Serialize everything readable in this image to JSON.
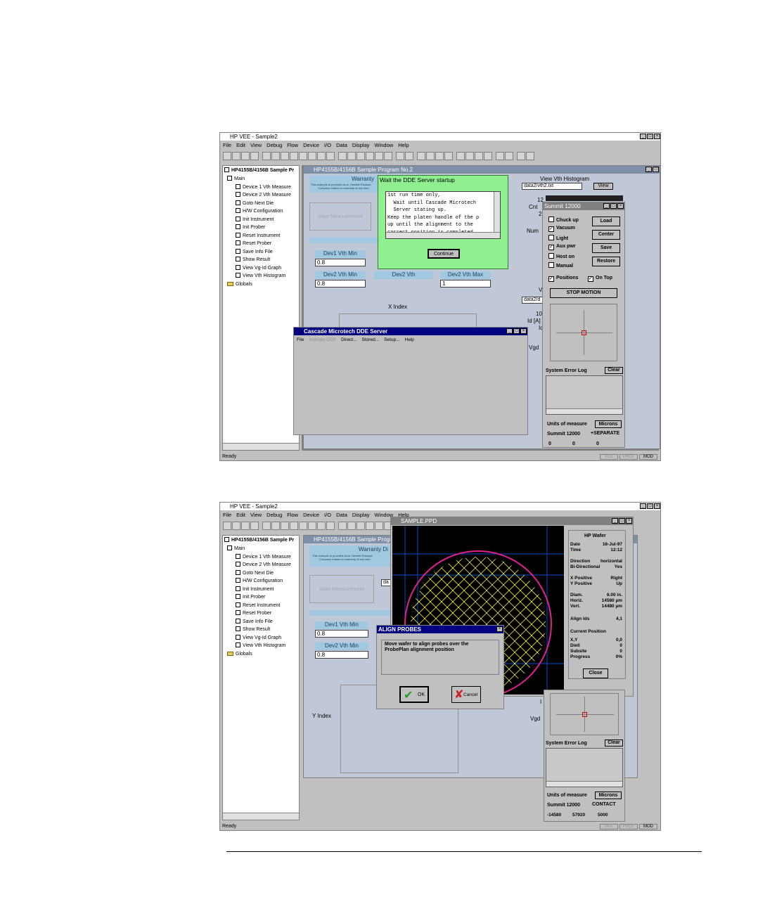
{
  "screen1": {
    "app_title": "HP VEE - Sample2",
    "menu": [
      "File",
      "Edit",
      "View",
      "Debug",
      "Flow",
      "Device",
      "I/O",
      "Data",
      "Display",
      "Window",
      "Help"
    ],
    "tree_root": "HP4155B/4156B Sample Pr",
    "tree_items": [
      "Main",
      "Device 1 Vth Measure",
      "Device 2 Vth Measure",
      "Goto Next Die",
      "H/W Configuration",
      "Init Instrument",
      "Init Prober",
      "Reset Instrument",
      "Reset Prober",
      "Save Info File",
      "Show Result",
      "View Vg-Id Graph",
      "View Vth Histogram",
      "Globals"
    ],
    "status_ready": "Ready",
    "status_indicators": [
      "VEE",
      "PROF",
      "MOD"
    ],
    "program_title": "HP4155B/4156B Sample Program No.2",
    "warranty_title": "Warranty",
    "warranty_text_1": "This example is provided as-is. Hewlett-Packard",
    "warranty_text_2": "Company makes no warranty of any kind",
    "start_button": "Start Measurement",
    "labels": {
      "dev1_vth_min": "Dev1 Vth Min",
      "dev2_vth_min": "Dev2 Vth Min",
      "dev2_vth": "Dev2 Vth",
      "dev2_vth_max": "Dev2 Vth Max"
    },
    "values": {
      "dev1_vth_min": "0.8",
      "dev2_vth_min": "0.8",
      "dev2_vth_max": "1"
    },
    "x_index": "X Index",
    "view_vth_histogram": "View Vth Histogram",
    "hist_file": "data2/vth2.txt",
    "view_button": "View",
    "side_labels": [
      "12",
      "Cnt",
      "2",
      "Num",
      "V",
      "data2/d",
      "10",
      "Id [A]",
      "Id",
      "Vgd"
    ],
    "dialog_title": "Wait the DDE Server startup",
    "dialog_lines": [
      "1st run time only,",
      "  Wait until Cascade Microtech",
      "  Server stating up.",
      "Keep the platen handle of the p",
      "up until the alignment to the",
      "correct position is completed"
    ],
    "continue_button": "Continue",
    "dde_title": "Cascade Microtech DDE Server",
    "dde_menu": [
      "File",
      "Activate DDE",
      "Direct...",
      "Stored...",
      "Setup...",
      "Help"
    ],
    "summit_title": "Summit 12000",
    "summit_checks": [
      {
        "label": "Chuck up",
        "checked": false
      },
      {
        "label": "Vacuum",
        "checked": true
      },
      {
        "label": "Light",
        "checked": false
      },
      {
        "label": "Aux pwr",
        "checked": true
      },
      {
        "label": "Host on",
        "checked": false
      },
      {
        "label": "Manual",
        "checked": false
      }
    ],
    "summit_buttons": [
      "Load",
      "Center",
      "Save",
      "Restore"
    ],
    "positions": "Positions",
    "on_top": "On Top",
    "stop_motion": "STOP MOTION",
    "system_error_log": "System Error Log",
    "clear_button": "Clear",
    "units_of_measure": "Units of measure",
    "microns_button": "Microns",
    "summit_model": "Summit 12000",
    "summit_mode": "+SEPARATE",
    "coords": [
      "0",
      "0",
      "0"
    ]
  },
  "screen2": {
    "app_title": "HP VEE - Sample2",
    "program_title": "HP4155B/4156B Sample Program No.2",
    "warranty_title": "Warranty Di",
    "warranty_text_1": "This example is provided as-is. Hewlett-Packard",
    "warranty_text_2": "Company makes no warranty of any kind",
    "start_button": "Start Measurement",
    "labels": {
      "dev1_vth_min": "Dev1 Vth Min",
      "dev2_vth_min": "Dev2 Vth Min"
    },
    "values": {
      "dev1_vth_min": "0.8",
      "dev2_vth_min": "0.8",
      "field_da": "da"
    },
    "y_index": "Y Index",
    "side_labels": [
      "I",
      "Vgd"
    ],
    "sample_title": "SAMPLE.PPD",
    "wafer_info": {
      "name": "HP Wafer",
      "date_label": "Date",
      "date": "16-Jul-97",
      "time_label": "Time",
      "time": "12:12",
      "direction_label": "Direction",
      "direction": "horizontal",
      "bidir_label": "Bi-Directional",
      "bidir": "Yes",
      "xpos_label": "X Positive",
      "xpos": "Right",
      "ypos_label": "Y Positive",
      "ypos": "Up",
      "diam_label": "Diam.",
      "diam": "6.00 in.",
      "horiz_label": "Horiz.",
      "horiz": "14580 µm",
      "vert_label": "Vert.",
      "vert": "14480 µm",
      "align_label": "Align Ids",
      "align": "4,1",
      "current_position": "Current Position",
      "xy_label": "X,Y",
      "xy": "0,0",
      "diell_label": "Diell",
      "diell": "0",
      "subsite_label": "Subsite",
      "subsite": "0",
      "progress_label": "Progress",
      "progress": "0%",
      "close_button": "Close"
    },
    "align_title": "ALIGN PROBES",
    "align_message": "Move wafer to align probes over the ProbePlan alignment position",
    "ok_button": "OK",
    "cancel_button": "Cancel",
    "system_error_log": "System Error Log",
    "clear_button": "Clear",
    "units_of_measure": "Units of measure",
    "microns_button": "Microns",
    "summit_model": "Summit 12000",
    "summit_mode": "CONTACT",
    "coords": [
      "-14580",
      "57920",
      "5000"
    ]
  },
  "colors": {
    "title_blue": "#000080",
    "dialog_green": "#90f090",
    "label_blue": "#a0c8e0",
    "wafer_circle": "#e0208c",
    "wafer_grid": "#e8e850",
    "map_lines": "#0050d0"
  }
}
